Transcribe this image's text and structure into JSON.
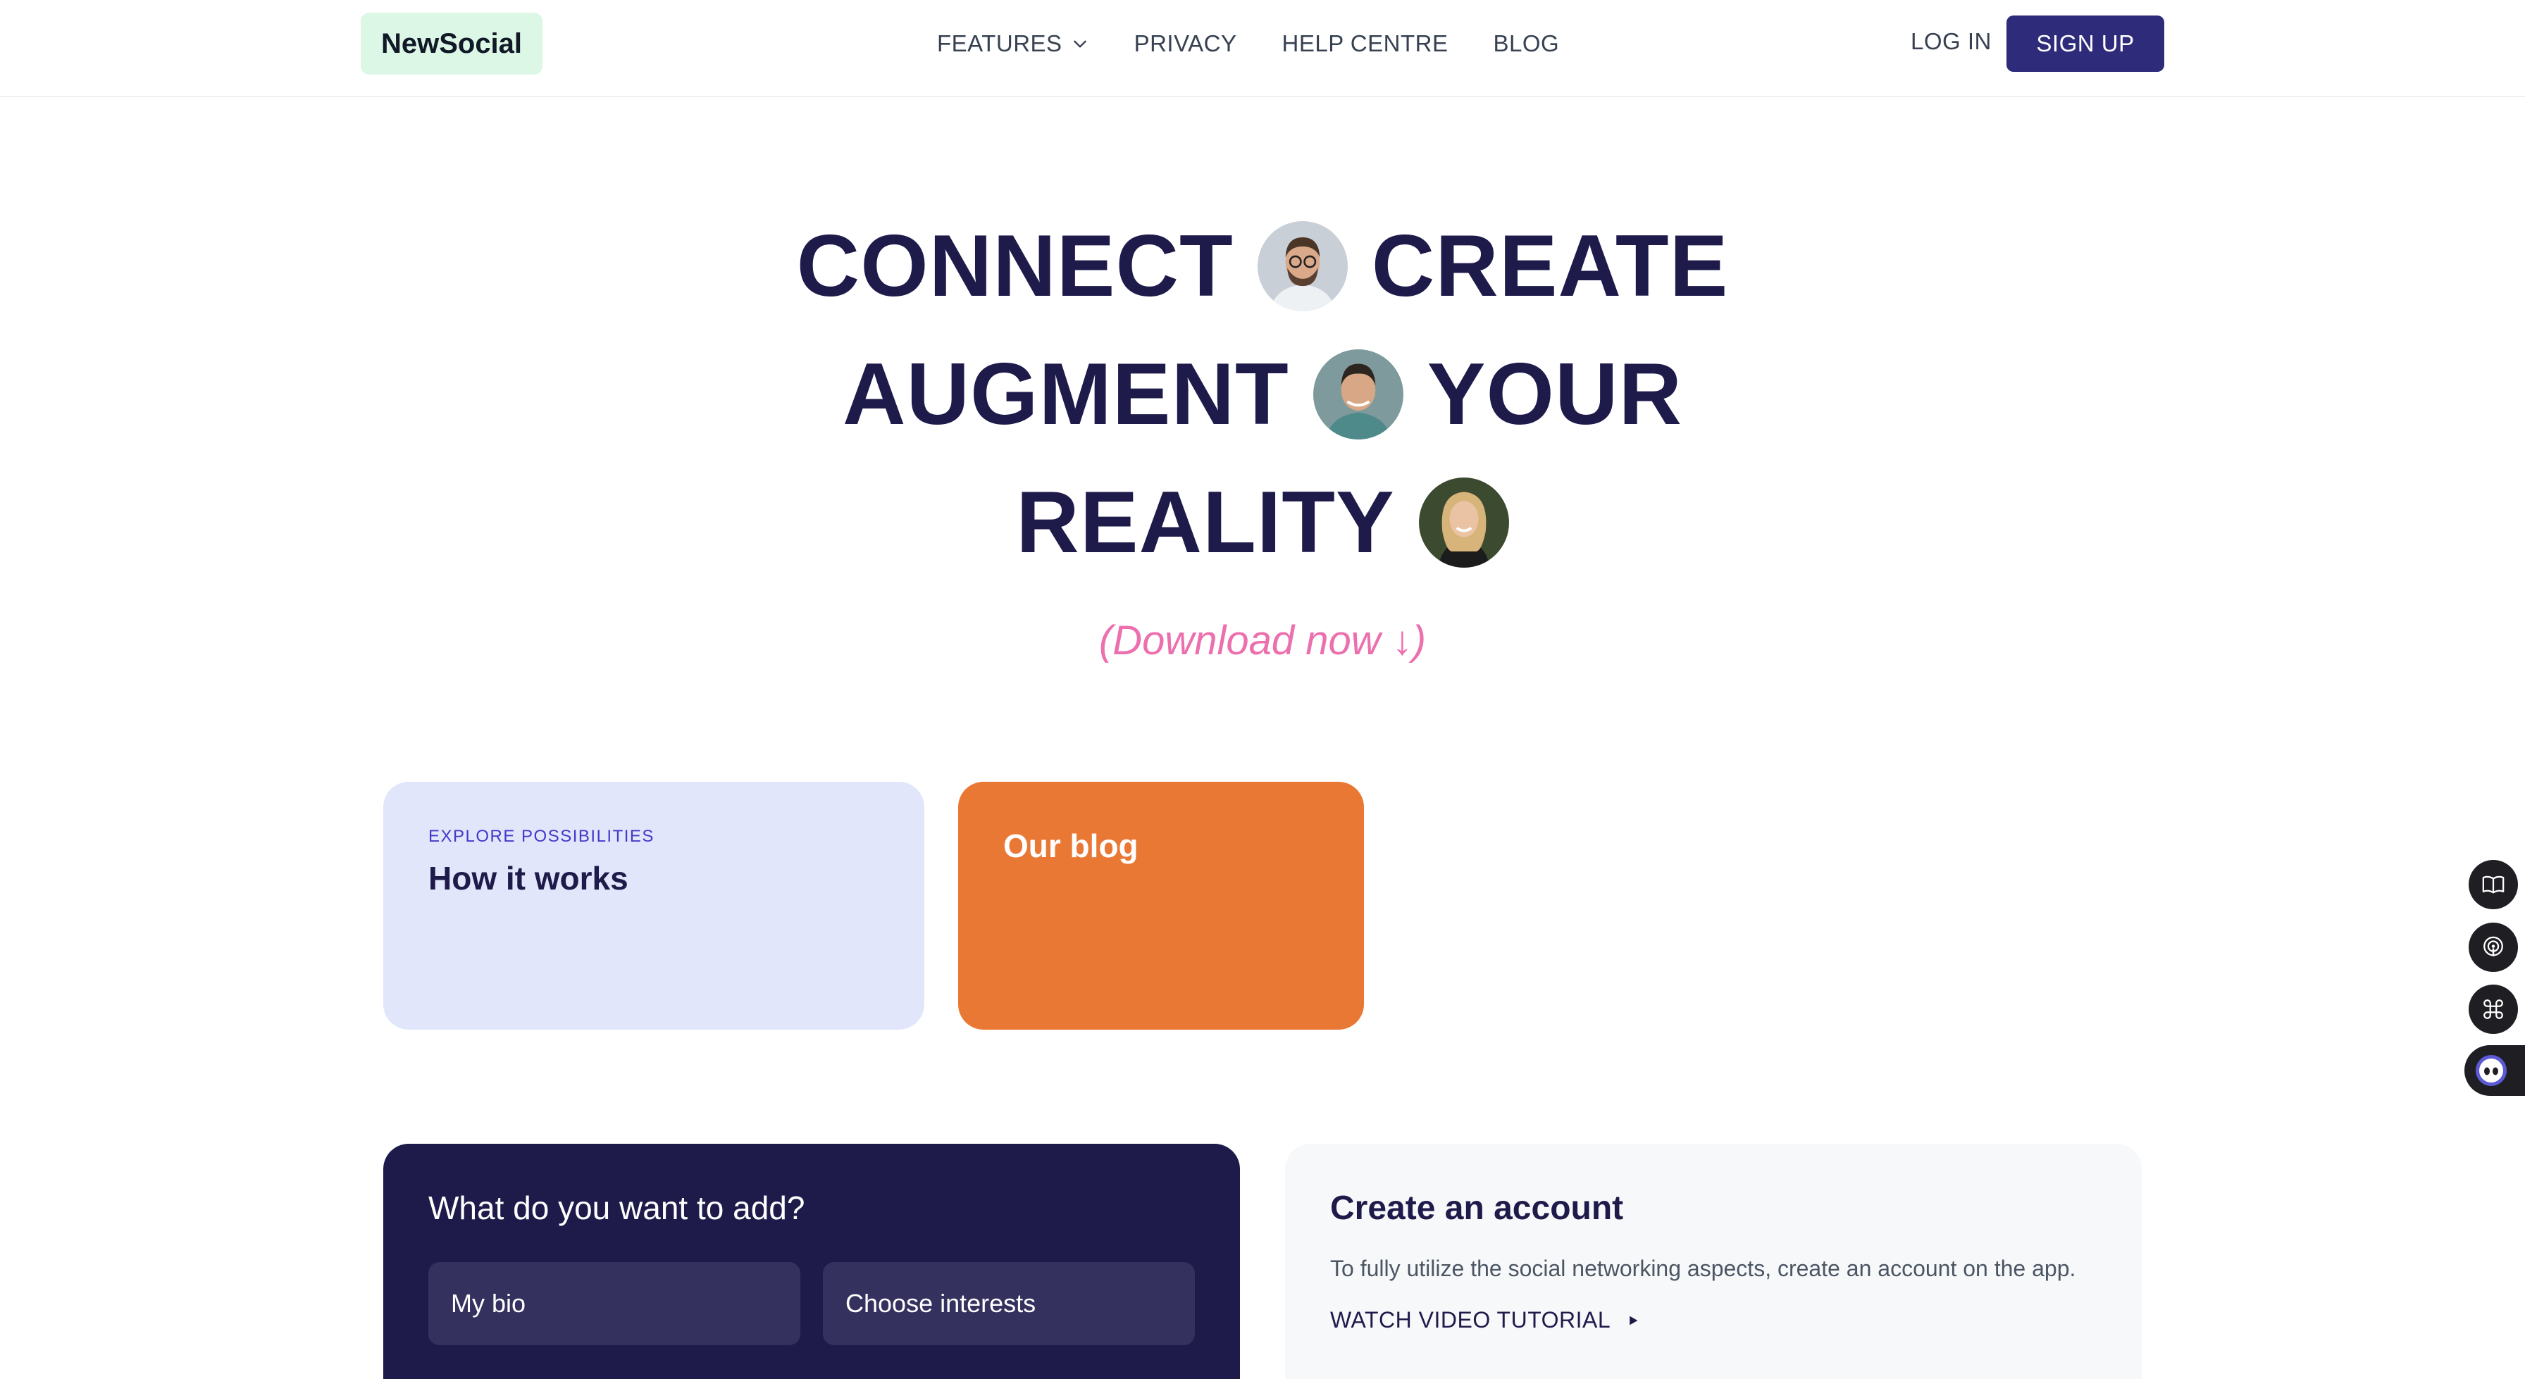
{
  "brand": {
    "name": "NewSocial"
  },
  "nav": {
    "links": [
      "FEATURES",
      "PRIVACY",
      "HELP CENTRE",
      "BLOG"
    ],
    "features_icon": "chevron-down-icon",
    "login": "LOG IN",
    "signup": "SIGN UP"
  },
  "hero": {
    "line1_word1": "CONNECT",
    "line1_word2": "CREATE",
    "line2_word1": "AUGMENT",
    "line2_word2": "YOUR",
    "line3_word1": "REALITY",
    "download": "(Download now ↓)"
  },
  "cards": {
    "how": {
      "eyebrow": "EXPLORE POSSIBILITIES",
      "title": "How it works"
    },
    "blog": {
      "title": "Our blog"
    }
  },
  "add_panel": {
    "title": "What do you want to add?",
    "options": [
      "My bio",
      "Choose interests"
    ]
  },
  "account_panel": {
    "title": "Create an account",
    "description": "To fully utilize the social networking aspects, create an account on the app.",
    "cta": "WATCH VIDEO TUTORIAL"
  },
  "side_toolbar": {
    "icons": [
      "book-icon",
      "podcast-icon",
      "command-icon",
      "assistant-icon"
    ]
  },
  "colors": {
    "brand_navy": "#1e1b4b",
    "signup_bg": "#2e2b7a",
    "logo_bg": "#dcf7e5",
    "accent_pink": "#ec6fae",
    "card_lavender": "#e1e6fb",
    "card_orange": "#e97835"
  }
}
